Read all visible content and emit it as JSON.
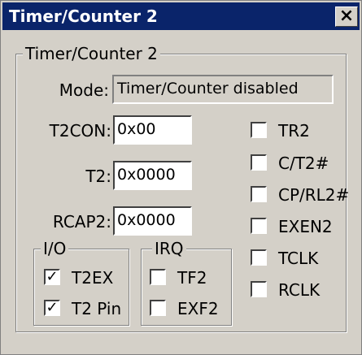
{
  "window": {
    "title": "Timer/Counter 2",
    "close_glyph": "×",
    "close_icon": "close-icon"
  },
  "group_main": {
    "label": "Timer/Counter 2"
  },
  "mode": {
    "label": "Mode:",
    "value": "Timer/Counter disabled"
  },
  "fields": {
    "t2con": {
      "label": "T2CON:",
      "value": "0x00"
    },
    "t2": {
      "label": "T2:",
      "value": "0x0000"
    },
    "rcap2": {
      "label": "RCAP2:",
      "value": "0x0000"
    }
  },
  "right_checks": [
    {
      "label": "TR2",
      "checked": false
    },
    {
      "label": "C/T2#",
      "checked": false
    },
    {
      "label": "CP/RL2#",
      "checked": false
    },
    {
      "label": "EXEN2",
      "checked": false
    },
    {
      "label": "TCLK",
      "checked": false
    },
    {
      "label": "RCLK",
      "checked": false
    }
  ],
  "io_group": {
    "label": "I/O",
    "items": [
      {
        "label": "T2EX",
        "checked": true
      },
      {
        "label": "T2 Pin",
        "checked": true
      }
    ]
  },
  "irq_group": {
    "label": "IRQ",
    "items": [
      {
        "label": "TF2",
        "checked": false
      },
      {
        "label": "EXF2",
        "checked": false
      }
    ]
  },
  "check_mark": "✓"
}
